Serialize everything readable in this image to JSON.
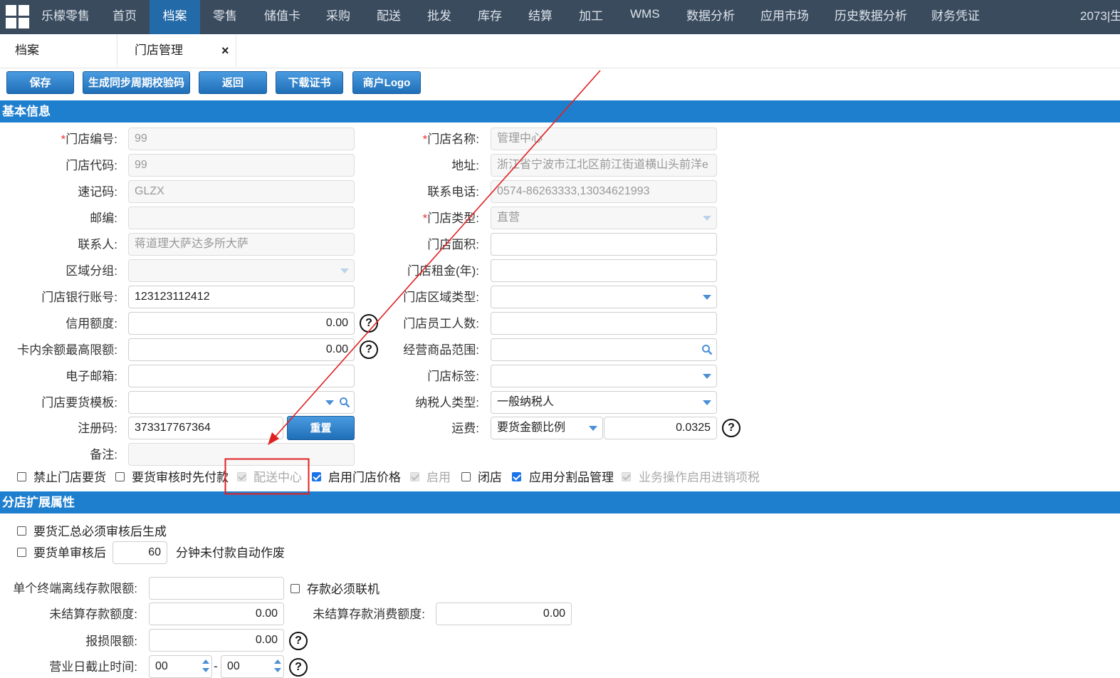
{
  "nav": {
    "brand": "乐檬零售",
    "items": [
      "首页",
      "档案",
      "零售",
      "储值卡",
      "采购",
      "配送",
      "批发",
      "库存",
      "结算",
      "加工",
      "WMS",
      "数据分析",
      "应用市场",
      "历史数据分析",
      "财务凭证"
    ],
    "user_fragment": "2073|生"
  },
  "tabs": {
    "breadcrumb": "档案",
    "active": "门店管理",
    "close": "×"
  },
  "toolbar": {
    "save": "保存",
    "gen_code": "生成同步周期校验码",
    "back": "返回",
    "download_cert": "下载证书",
    "logo": "商户Logo"
  },
  "basic": {
    "title": "基本信息",
    "store_no": {
      "label": "门店编号:",
      "value": "99"
    },
    "store_code": {
      "label": "门店代码:",
      "value": "99"
    },
    "mnemonic": {
      "label": "速记码:",
      "value": "GLZX"
    },
    "zip": {
      "label": "邮编:",
      "value": ""
    },
    "contact": {
      "label": "联系人:",
      "value": "蒋道理大萨达多所大萨"
    },
    "region_group": {
      "label": "区域分组:",
      "value": ""
    },
    "bank_account": {
      "label": "门店银行账号:",
      "value": "123123112412"
    },
    "credit": {
      "label": "信用额度:",
      "value": "0.00"
    },
    "card_max": {
      "label": "卡内余额最高限额:",
      "value": "0.00"
    },
    "email": {
      "label": "电子邮箱:",
      "value": ""
    },
    "order_template": {
      "label": "门店要货模板:",
      "value": ""
    },
    "reg_code": {
      "label": "注册码:",
      "value": "373317767364",
      "reset": "重置"
    },
    "remark": {
      "label": "备注:",
      "value": ""
    },
    "store_name": {
      "label": "门店名称:",
      "value": "管理中心"
    },
    "address": {
      "label": "地址:",
      "value": "浙江省宁波市江北区前江街道横山头前洋e"
    },
    "phone": {
      "label": "联系电话:",
      "value": "0574-86263333,13034621993"
    },
    "store_type": {
      "label": "门店类型:",
      "value": "直营"
    },
    "area": {
      "label": "门店面积:",
      "value": ""
    },
    "rent": {
      "label": "门店租金(年):",
      "value": ""
    },
    "region_type": {
      "label": "门店区域类型:",
      "value": ""
    },
    "staff": {
      "label": "门店员工人数:",
      "value": ""
    },
    "scope": {
      "label": "经营商品范围:",
      "value": ""
    },
    "tags": {
      "label": "门店标签:",
      "value": ""
    },
    "taxpayer": {
      "label": "纳税人类型:",
      "value": "一般纳税人"
    },
    "freight": {
      "label": "运费:",
      "mode": "要货金额比例",
      "value": "0.0325"
    },
    "checks": [
      {
        "label": "禁止门店要货",
        "checked": false,
        "disabled": false
      },
      {
        "label": "要货审核时先付款",
        "checked": false,
        "disabled": false
      },
      {
        "label": "配送中心",
        "checked": true,
        "disabled": true
      },
      {
        "label": "启用门店价格",
        "checked": true,
        "disabled": false
      },
      {
        "label": "启用",
        "checked": true,
        "disabled": true
      },
      {
        "label": "闭店",
        "checked": false,
        "disabled": false
      },
      {
        "label": "应用分割品管理",
        "checked": true,
        "disabled": false
      },
      {
        "label": "业务操作启用进销项税",
        "checked": true,
        "disabled": true
      }
    ]
  },
  "ext": {
    "title": "分店扩展属性",
    "summary_check": "要货汇总必须审核后生成",
    "order_check_pre": "要货单审核后",
    "order_minutes": "60",
    "order_check_post": "分钟未付款自动作废",
    "offline_limit": {
      "label": "单个终端离线存款限额:",
      "value": ""
    },
    "deposit_online": "存款必须联机",
    "unsettled": {
      "label": "未结算存款额度:",
      "value": "0.00"
    },
    "unsettled_consume": {
      "label": "未结算存款消费额度:",
      "value": "0.00"
    },
    "loss_limit": {
      "label": "报损限额:",
      "value": "0.00"
    },
    "cutoff": {
      "label": "营业日截止时间:",
      "hour": "00",
      "sep": "-",
      "minute": "00"
    }
  },
  "colors": {
    "nav_bg": "#3a4b5e",
    "nav_active": "#236aa8",
    "section": "#1f7fcf",
    "annotation": "#e02020"
  }
}
